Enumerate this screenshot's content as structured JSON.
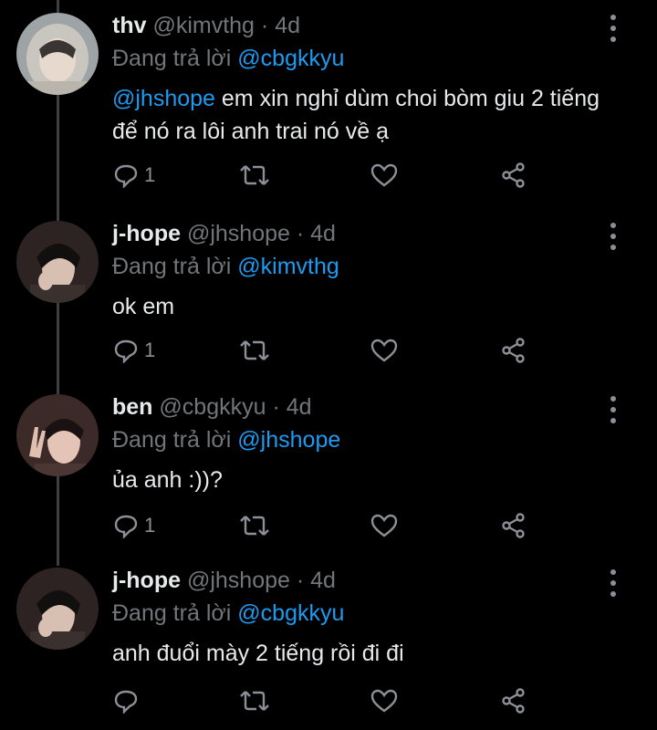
{
  "colors": {
    "background": "#000000",
    "text": "#e7e9ea",
    "muted": "#71767b",
    "mention": "#1d9bf0"
  },
  "tweets": [
    {
      "name": "thv",
      "handle": "@kimvthg",
      "time": "4d",
      "reply_prefix": "Đang trả lời",
      "reply_to": "@cbgkkyu",
      "body_mention": "@jhshope",
      "body": " em xin nghỉ dùm choi bòm giu 2 tiếng để nó ra lôi anh trai nó về ạ",
      "reply_count": "1",
      "icons": [
        "reply-icon",
        "retweet-icon",
        "like-icon",
        "share-icon",
        "more-icon"
      ]
    },
    {
      "name": "j-hope",
      "handle": "@jhshope",
      "time": "4d",
      "reply_prefix": "Đang trả lời",
      "reply_to": "@kimvthg",
      "body_mention": "",
      "body": "ok em",
      "reply_count": "1",
      "icons": [
        "reply-icon",
        "retweet-icon",
        "like-icon",
        "share-icon",
        "more-icon"
      ]
    },
    {
      "name": "ben",
      "handle": "@cbgkkyu",
      "time": "4d",
      "reply_prefix": "Đang trả lời",
      "reply_to": "@jhshope",
      "body_mention": "",
      "body": "ủa anh :))?",
      "reply_count": "1",
      "icons": [
        "reply-icon",
        "retweet-icon",
        "like-icon",
        "share-icon",
        "more-icon"
      ]
    },
    {
      "name": "j-hope",
      "handle": "@jhshope",
      "time": "4d",
      "reply_prefix": "Đang trả lời",
      "reply_to": "@cbgkkyu",
      "body_mention": "",
      "body": "anh đuổi mày 2 tiếng rồi đi đi",
      "reply_count": "",
      "icons": [
        "reply-icon",
        "retweet-icon",
        "like-icon",
        "share-icon",
        "more-icon"
      ]
    }
  ]
}
